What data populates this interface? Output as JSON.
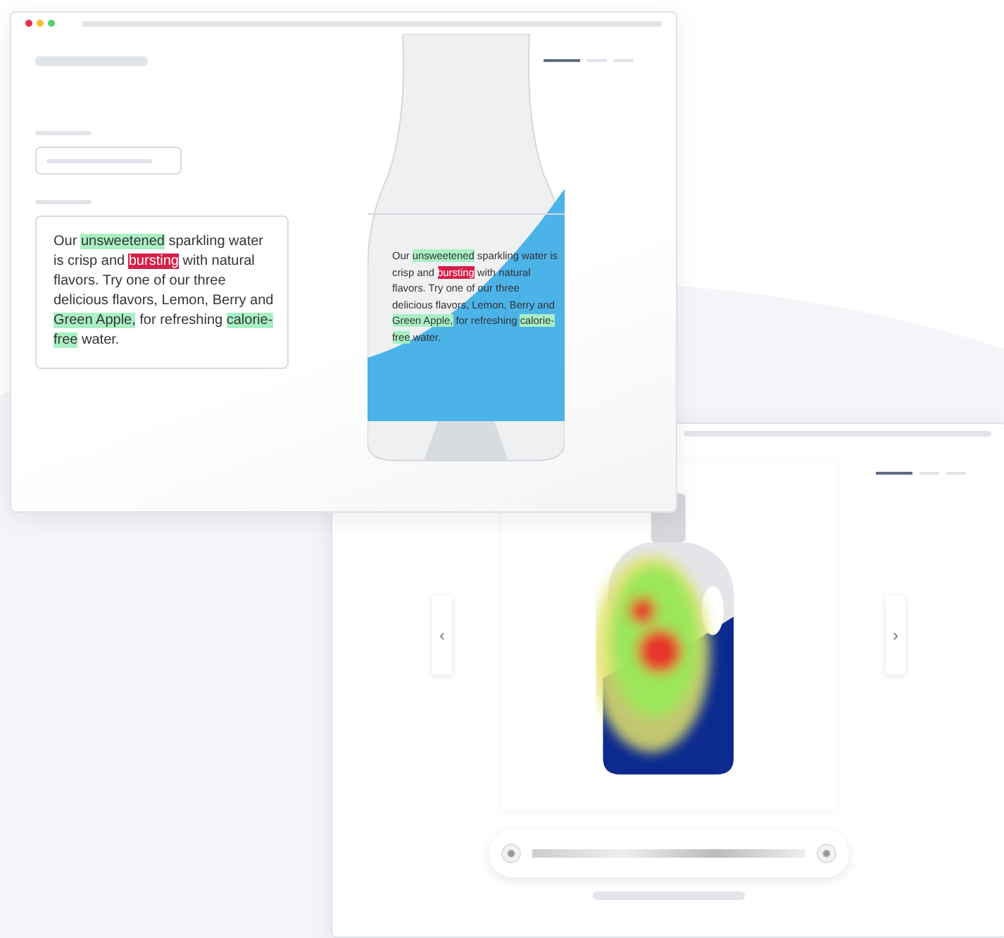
{
  "front_window": {
    "pager": [
      {
        "selected": true
      },
      {
        "selected": false
      },
      {
        "selected": false
      }
    ],
    "copy_card": [
      {
        "text": "Our ",
        "kind": "plain"
      },
      {
        "text": "unsweetened",
        "kind": "positive"
      },
      {
        "text": " sparkling water is crisp and ",
        "kind": "plain"
      },
      {
        "text": "bursting",
        "kind": "negative"
      },
      {
        "text": " with natural flavors. Try one of our three delicious flavors, Lemon, Berry and ",
        "kind": "plain"
      },
      {
        "text": "Green Apple,",
        "kind": "positive"
      },
      {
        "text": " for refreshing ",
        "kind": "plain"
      },
      {
        "text": "calorie-free",
        "kind": "positive"
      },
      {
        "text": " water.",
        "kind": "plain"
      }
    ],
    "label_copy": [
      {
        "text": "Our ",
        "kind": "plain"
      },
      {
        "text": "unsweetened",
        "kind": "positive"
      },
      {
        "text": " sparkling water is crisp and ",
        "kind": "plain"
      },
      {
        "text": "bursting",
        "kind": "negative"
      },
      {
        "text": " with natural flavors. Try one of our three delicious flavors, Lemon, Berry and ",
        "kind": "plain"
      },
      {
        "text": "Green Apple,",
        "kind": "positive"
      },
      {
        "text": " for refreshing ",
        "kind": "plain"
      },
      {
        "text": "calorie-free",
        "kind": "positive"
      },
      {
        "text": " water.",
        "kind": "plain"
      }
    ]
  },
  "back_window": {
    "pager": [
      {
        "selected": true
      },
      {
        "selected": false
      },
      {
        "selected": false
      }
    ],
    "prev": "‹",
    "next": "›"
  }
}
